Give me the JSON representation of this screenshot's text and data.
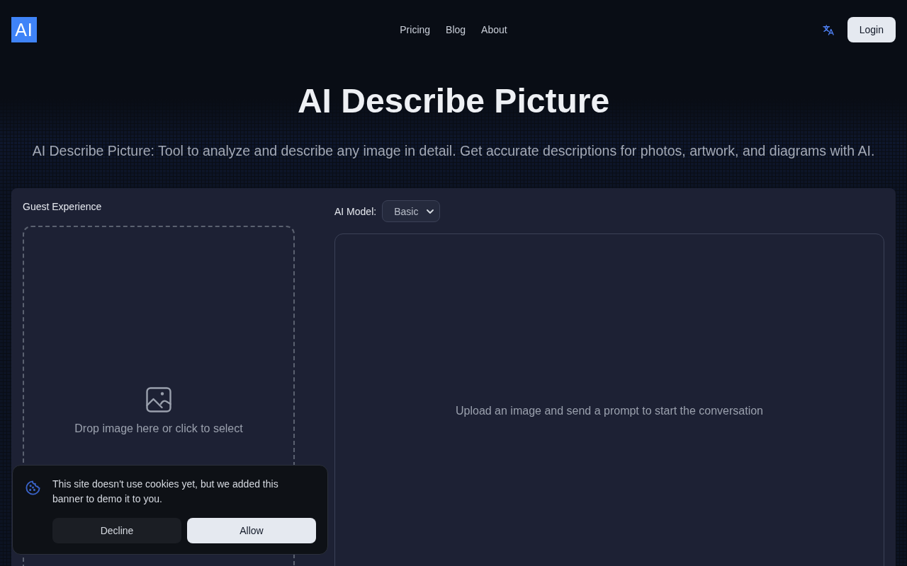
{
  "header": {
    "logo": "AI",
    "nav": [
      {
        "label": "Pricing"
      },
      {
        "label": "Blog"
      },
      {
        "label": "About"
      }
    ],
    "login_button": "Login"
  },
  "hero": {
    "title": "AI Describe Picture",
    "subtitle": "AI Describe Picture: Tool to analyze and describe any image in detail. Get accurate descriptions for photos, artwork, and diagrams with AI."
  },
  "upload_panel": {
    "heading": "Guest Experience",
    "dropzone_text": "Drop image here or click to select"
  },
  "chat_panel": {
    "model_label": "AI Model:",
    "model_value": "Basic",
    "empty_message": "Upload an image and send a prompt to start the conversation"
  },
  "cookie_banner": {
    "message": "This site doesn't use cookies yet, but we added this banner to demo it to you.",
    "buttons": [
      {
        "label": "Decline",
        "kind": "secondary"
      },
      {
        "label": "Allow",
        "kind": "primary"
      }
    ]
  }
}
